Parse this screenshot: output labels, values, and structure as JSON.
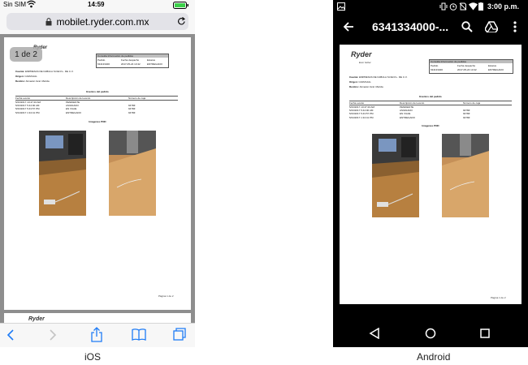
{
  "ios": {
    "status": {
      "carrier": "Sin SIM",
      "time": "14:59"
    },
    "url": "mobilet.ryder.com.mx",
    "page_indicator": "1 de 2",
    "caption": "iOS"
  },
  "android": {
    "status": {
      "time": "3:00 p.m."
    },
    "title": "6341334000-...",
    "caption": "Android"
  },
  "document": {
    "logo": "Ryder",
    "logo_tagline": "Ever better.",
    "header_box_title": "Consulta Información de pedidos",
    "header_cols": [
      "Pedido",
      "Fecha despacho",
      "Estatus"
    ],
    "header_vals": [
      "634133400",
      "2017-05-24 13:42",
      "ENTREGADO"
    ],
    "fields": [
      {
        "label": "Cuenta:",
        "value": "EMPRESAS DE FABULA S.DE R.L. DE C.V."
      },
      {
        "label": "Origen:",
        "value": "CARVAJAL"
      },
      {
        "label": "Destino:",
        "value": "Almacén Gral. Mérida"
      }
    ],
    "events_title": "Eventos del pedido",
    "events_cols": [
      "Fecha evento",
      "Descripción del evento",
      "Número de caja"
    ],
    "events": [
      [
        "5/23/2017 10:47:20 AM",
        "PENDIENTE",
        ""
      ],
      [
        "5/23/2017 5:44:00 AM",
        "ASIGNADO",
        "9478Z"
      ],
      [
        "5/23/2017 5:43:57 PM",
        "EN VIAJE",
        "9478Z"
      ],
      [
        "5/24/2017 1:34:41 PM",
        "ENTREGADO",
        "9478Z"
      ]
    ],
    "images_title": "Imagenes POD",
    "footer": "Página 1 de 2"
  },
  "colors": {
    "ios_bar": "#f7f7f7",
    "ios_tint": "#1f7cf6",
    "android_bar": "#000000"
  }
}
